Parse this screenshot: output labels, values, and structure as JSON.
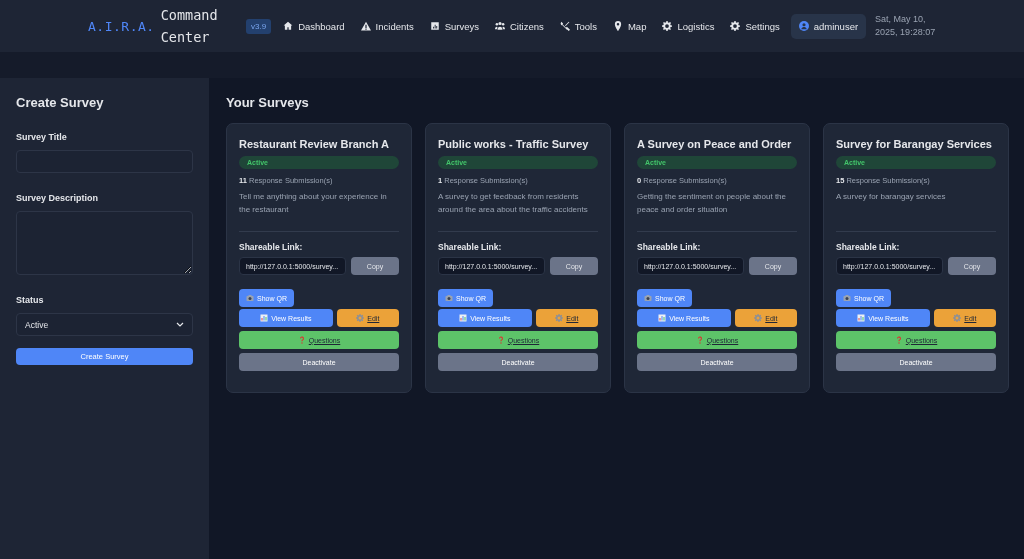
{
  "header": {
    "logo_mark": "A.I.R.A.",
    "logo_title": "Command Center",
    "version": "v3.9",
    "nav": [
      {
        "label": "Dashboard",
        "kind": "home"
      },
      {
        "label": "Incidents",
        "kind": "warning"
      },
      {
        "label": "Surveys",
        "kind": "poll"
      },
      {
        "label": "Citizens",
        "kind": "users"
      },
      {
        "label": "Tools",
        "kind": "tools"
      },
      {
        "label": "Map",
        "kind": "pin"
      },
      {
        "label": "Logistics",
        "kind": "gear"
      },
      {
        "label": "Settings",
        "kind": "gear"
      }
    ],
    "user": "adminuser",
    "datetime": "Sat, May 10, 2025, 19:28:07"
  },
  "sidebar": {
    "title": "Create Survey",
    "fields": [
      {
        "label": "Survey Title",
        "kind": "text"
      },
      {
        "label": "Survey Description",
        "kind": "textarea"
      },
      {
        "label": "Status",
        "kind": "select",
        "value": "Active"
      }
    ],
    "submit": "Create Survey"
  },
  "main": {
    "heading": "Your Surveys",
    "surveys": [
      {
        "title": "Restaurant Review Branch A",
        "status": {
          "label": "Active",
          "kind": "active"
        },
        "count": "11",
        "count_label": "Response Submission(s)",
        "description": "Tell me anything about your experience in the restaurant",
        "link_label": "Shareable Link:",
        "link": "http://127.0.0.1:5000/survey...",
        "copy": "Copy",
        "actions": [
          {
            "kind": "qr",
            "label": "Show QR"
          },
          {
            "kind": "results",
            "label": "View Results"
          },
          {
            "kind": "edit",
            "label": "Edit"
          },
          {
            "kind": "questions",
            "label": "Questions"
          },
          {
            "kind": "toggle",
            "label": "Deactivate"
          }
        ]
      },
      {
        "title": "Public works - Traffic Survey",
        "status": {
          "label": "Active",
          "kind": "active"
        },
        "count": "1",
        "count_label": "Response Submission(s)",
        "description": "A survey to get feedback from residents around the area about the traffic accidents",
        "link_label": "Shareable Link:",
        "link": "http://127.0.0.1:5000/survey...",
        "copy": "Copy",
        "actions": [
          {
            "kind": "qr",
            "label": "Show QR"
          },
          {
            "kind": "results",
            "label": "View Results"
          },
          {
            "kind": "edit",
            "label": "Edit"
          },
          {
            "kind": "questions",
            "label": "Questions"
          },
          {
            "kind": "toggle",
            "label": "Deactivate"
          }
        ]
      },
      {
        "title": "A Survey on Peace and Order",
        "status": {
          "label": "Active",
          "kind": "active"
        },
        "count": "0",
        "count_label": "Response Submission(s)",
        "description": "Getting the sentiment on people about the peace and order situation",
        "link_label": "Shareable Link:",
        "link": "http://127.0.0.1:5000/survey...",
        "copy": "Copy",
        "actions": [
          {
            "kind": "qr",
            "label": "Show QR"
          },
          {
            "kind": "results",
            "label": "View Results"
          },
          {
            "kind": "edit",
            "label": "Edit"
          },
          {
            "kind": "questions",
            "label": "Questions"
          },
          {
            "kind": "toggle",
            "label": "Deactivate"
          }
        ]
      },
      {
        "title": "Survey for Barangay Services",
        "status": {
          "label": "Active",
          "kind": "active"
        },
        "count": "15",
        "count_label": "Response Submission(s)",
        "description": "A survey for barangay services",
        "link_label": "Shareable Link:",
        "link": "http://127.0.0.1:5000/survey...",
        "copy": "Copy",
        "actions": [
          {
            "kind": "qr",
            "label": "Show QR"
          },
          {
            "kind": "results",
            "label": "View Results"
          },
          {
            "kind": "edit",
            "label": "Edit"
          },
          {
            "kind": "questions",
            "label": "Questions"
          },
          {
            "kind": "toggle",
            "label": "Deactivate"
          }
        ]
      }
    ]
  }
}
